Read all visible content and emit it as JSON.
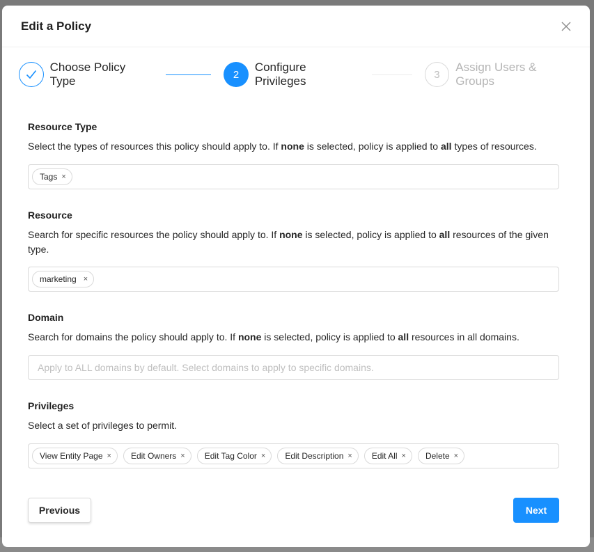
{
  "modal": {
    "title": "Edit a Policy"
  },
  "steps": [
    {
      "number": "1",
      "label": "Choose Policy Type",
      "state": "done"
    },
    {
      "number": "2",
      "label": "Configure Privileges",
      "state": "active"
    },
    {
      "number": "3",
      "label": "Assign Users & Groups",
      "state": "pending"
    }
  ],
  "resource_type": {
    "title": "Resource Type",
    "desc_pre": "Select the types of resources this policy should apply to. If ",
    "desc_none": "none",
    "desc_mid": " is selected, policy is applied to ",
    "desc_all": "all",
    "desc_post": " types of resources.",
    "tags": [
      "Tags"
    ]
  },
  "resource": {
    "title": "Resource",
    "desc_pre": "Search for specific resources the policy should apply to. If ",
    "desc_none": "none",
    "desc_mid": " is selected, policy is applied to ",
    "desc_all": "all",
    "desc_post": " resources of the given type.",
    "tags": [
      "marketing"
    ]
  },
  "domain": {
    "title": "Domain",
    "desc_pre": "Search for domains the policy should apply to. If ",
    "desc_none": "none",
    "desc_mid": " is selected, policy is applied to ",
    "desc_all": "all",
    "desc_post": " resources in all domains.",
    "placeholder": "Apply to ALL domains by default. Select domains to apply to specific domains."
  },
  "privileges": {
    "title": "Privileges",
    "desc": "Select a set of privileges to permit.",
    "tags": [
      "View Entity Page",
      "Edit Owners",
      "Edit Tag Color",
      "Edit Description",
      "Edit All",
      "Delete"
    ]
  },
  "buttons": {
    "previous": "Previous",
    "next": "Next"
  },
  "icons": {
    "close": "close-icon",
    "check": "check-icon",
    "tag_remove": "×"
  },
  "colors": {
    "primary": "#1890ff",
    "border": "#d9d9d9",
    "muted": "#b5b5b5"
  }
}
